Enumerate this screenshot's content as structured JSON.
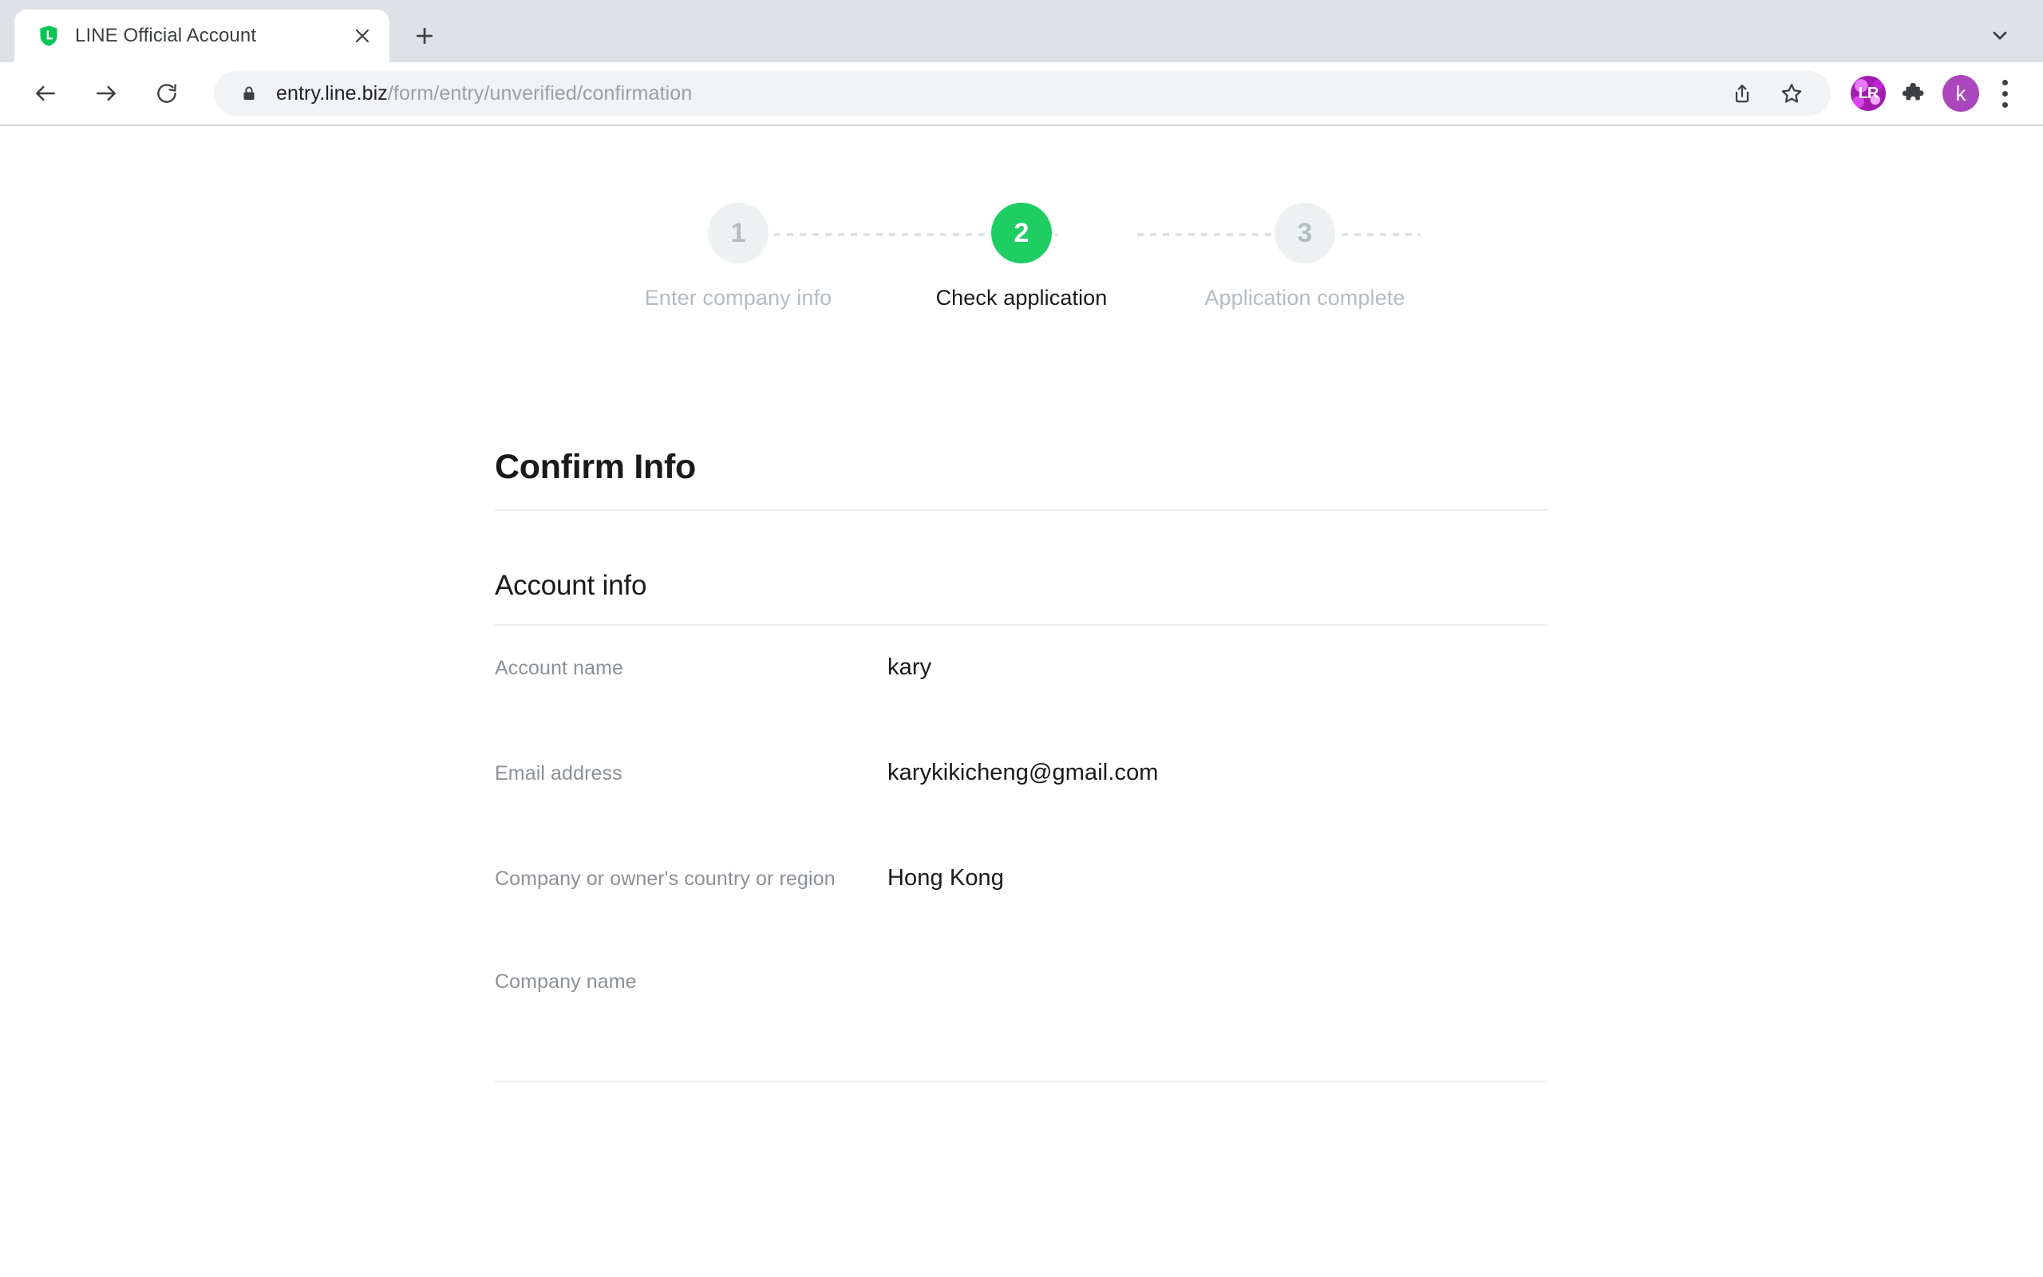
{
  "browser": {
    "tab": {
      "title": "LINE Official Account",
      "favicon_icon": "line-shield-icon",
      "close_icon": "close-icon"
    },
    "new_tab_icon": "plus-icon",
    "tab_search_icon": "chevron-down-icon",
    "nav": {
      "back_icon": "arrow-left-icon",
      "forward_icon": "arrow-right-icon",
      "reload_icon": "reload-icon"
    },
    "omnibox": {
      "lock_icon": "lock-icon",
      "url_host": "entry.line.biz",
      "url_path": "/form/entry/unverified/confirmation",
      "url_full": "entry.line.biz/form/entry/unverified/confirmation",
      "share_icon": "share-icon",
      "bookmark_icon": "star-icon"
    },
    "extensions": {
      "lr_label": "LR",
      "lr_icon": "extension-lr-icon",
      "puzzle_icon": "puzzle-piece-icon"
    },
    "profile": {
      "avatar_initial": "k",
      "avatar_color": "#ab47bc"
    },
    "menu_icon": "three-dot-menu-icon"
  },
  "stepper": {
    "active_color": "#1ece63",
    "inactive_color": "#eef1f2",
    "steps": [
      {
        "number": "1",
        "label": "Enter company info",
        "state": "inactive"
      },
      {
        "number": "2",
        "label": "Check application",
        "state": "active"
      },
      {
        "number": "3",
        "label": "Application complete",
        "state": "inactive"
      }
    ]
  },
  "main": {
    "page_title": "Confirm Info",
    "section_title": "Account info",
    "rows": [
      {
        "label": "Account name",
        "value": "kary"
      },
      {
        "label": "Email address",
        "value": "karykikicheng@gmail.com"
      },
      {
        "label": "Company or owner's country or region",
        "value": "Hong Kong"
      },
      {
        "label": "Company name",
        "value": ""
      }
    ]
  }
}
